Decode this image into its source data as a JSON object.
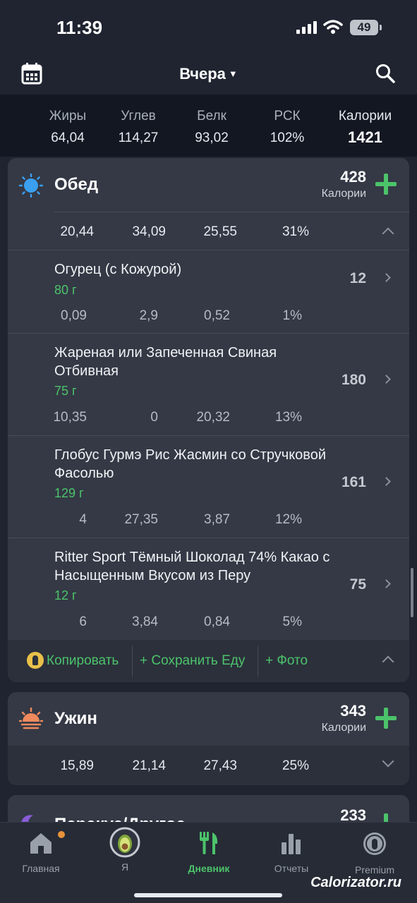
{
  "status": {
    "time": "11:39",
    "battery": "49"
  },
  "header": {
    "title": "Вчера",
    "calendar_icon": "calendar-icon",
    "search_icon": "search-icon"
  },
  "summary": {
    "fat_label": "Жиры",
    "fat": "64,04",
    "carb_label": "Углев",
    "carb": "114,27",
    "protein_label": "Белк",
    "protein": "93,02",
    "rdi_label": "РСК",
    "rdi": "102%",
    "cal_label": "Калории",
    "cal": "1421"
  },
  "lunch": {
    "name": "Обед",
    "calories": "428",
    "cal_label": "Калории",
    "icon": "sun-icon",
    "totals": [
      "20,44",
      "34,09",
      "25,55",
      "31%"
    ],
    "foods": [
      {
        "name": "Огурец (с Кожурой)",
        "grams": "80 г",
        "cal": "12",
        "macros": [
          "0,09",
          "2,9",
          "0,52",
          "1%"
        ]
      },
      {
        "name": "Жареная или Запеченная Свиная Отбивная",
        "grams": "75 г",
        "cal": "180",
        "macros": [
          "10,35",
          "0",
          "20,32",
          "13%"
        ]
      },
      {
        "name": "Глобус Гурмэ Рис Жасмин со Стручковой Фасолью",
        "grams": "129 г",
        "cal": "161",
        "macros": [
          "4",
          "27,35",
          "3,87",
          "12%"
        ]
      },
      {
        "name": "Ritter Sport Тёмный Шоколад 74% Какао с Насыщенным Вкусом из Перу",
        "grams": "12 г",
        "cal": "75",
        "macros": [
          "6",
          "3,84",
          "0,84",
          "5%"
        ]
      }
    ],
    "actions": {
      "copy": "Копировать",
      "save": "+ Сохранить Еду",
      "photo": "+ Фото"
    }
  },
  "dinner": {
    "name": "Ужин",
    "calories": "343",
    "cal_label": "Калории",
    "icon": "sunset-icon",
    "totals": [
      "15,89",
      "21,14",
      "27,43",
      "25%"
    ]
  },
  "snack": {
    "name": "Перекус/Другое",
    "calories": "233",
    "icon": "moon-icon"
  },
  "tabs": [
    {
      "label": "Главная",
      "icon": "home-icon"
    },
    {
      "label": "Я",
      "icon": "avatar-icon"
    },
    {
      "label": "Дневник",
      "icon": "fork-knife-icon"
    },
    {
      "label": "Отчеты",
      "icon": "bar-chart-icon"
    },
    {
      "label": "Premium",
      "icon": "premium-lock-icon"
    }
  ],
  "watermark": "Calorizator.ru",
  "colors": {
    "accent": "#4cc36a",
    "background": "#1f2430",
    "card": "#343945"
  }
}
